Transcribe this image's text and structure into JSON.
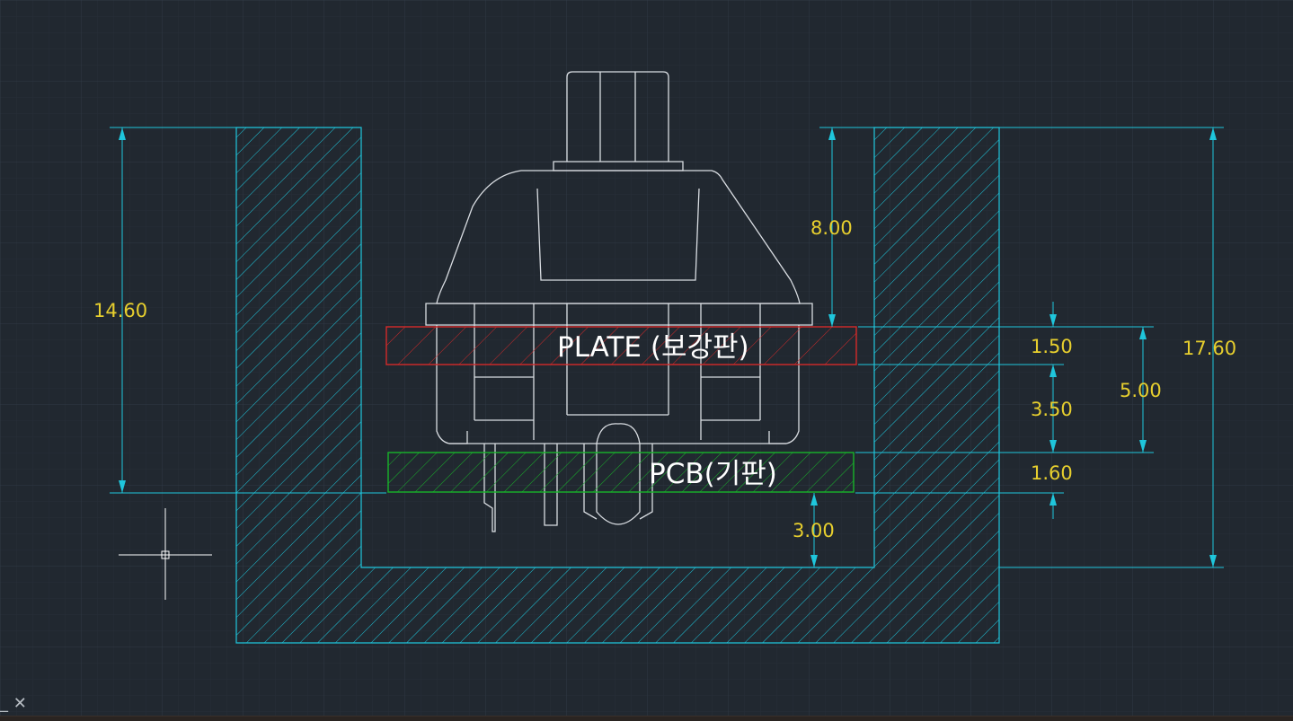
{
  "drawing": {
    "plate_label": "PLATE (보강판)",
    "pcb_label": "PCB(기판)",
    "dimensions": {
      "left_height": "14.60",
      "top_gap": "8.00",
      "plate_thickness": "1.50",
      "plate_to_pcb": "3.50",
      "pcb_thickness": "1.60",
      "bottom_gap": "3.00",
      "plate_to_pcb_bottom": "5.00",
      "total_height": "17.60"
    },
    "colors": {
      "background": "#212830",
      "grid": "#2c3540",
      "case": "#1fc6dc",
      "plate": "#d42a2a",
      "pcb": "#18b52a",
      "switch": "#d9dde2",
      "dimension_text": "#e7cf2e"
    }
  },
  "command_line": {
    "icon": "close-icon",
    "prompt_glyph": "_",
    "close_glyph": "✕"
  }
}
